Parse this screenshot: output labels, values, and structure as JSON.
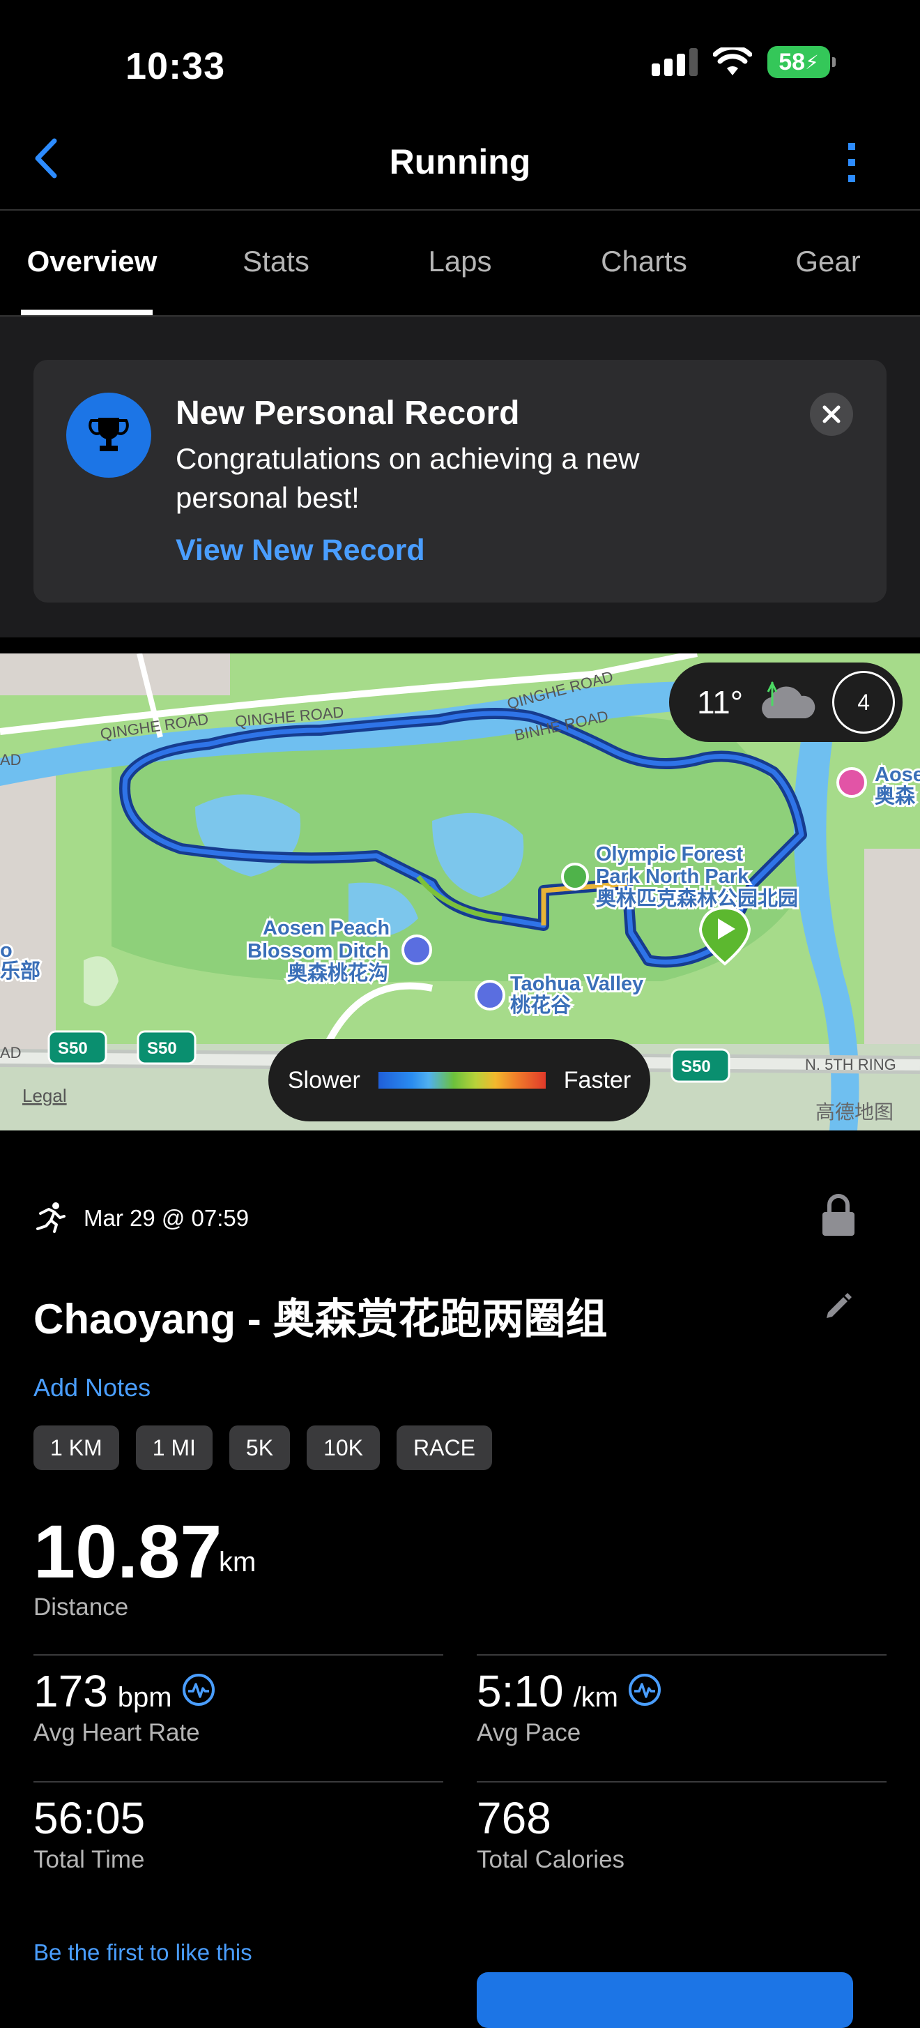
{
  "status": {
    "time": "10:33",
    "battery": "58"
  },
  "nav": {
    "title": "Running"
  },
  "tabs": [
    "Overview",
    "Stats",
    "Laps",
    "Charts",
    "Gear"
  ],
  "record_card": {
    "title": "New Personal Record",
    "text": "Congratulations on achieving a new personal best!",
    "link": "View New Record"
  },
  "map": {
    "weather_temp": "11°",
    "weather_badge": "4",
    "legend_slow": "Slower",
    "legend_fast": "Faster",
    "legal": "Legal",
    "provider": "高德地图",
    "labels": {
      "qinghe_road_1": "QINGHE ROAD",
      "qinghe_road_2": "QINGHE ROAD",
      "qinghe_road_3": "QINGHE ROAD",
      "binhe_road": "BINHE ROAD",
      "n5th_ring": "N. 5TH RING",
      "s50": "S50",
      "olympic_en_1": "Olympic Forest",
      "olympic_en_2": "Park North Park",
      "olympic_cn": "奥林匹克森林公园北园",
      "aosen_en_1": "Aosen Peach",
      "aosen_en_2": "Blossom Ditch",
      "aosen_cn": "奥森桃花沟",
      "taohua_en": "Taohua Valley",
      "taohua_cn": "桃花谷",
      "edge_right_en": "Aose",
      "edge_right_cn": "奥森",
      "edge_left_cn": "乐部",
      "edge_left_en": "o",
      "edge_ad_1": "AD",
      "edge_ad_2": "AD"
    }
  },
  "activity": {
    "date": "Mar 29 @ 07:59",
    "title": "Chaoyang - 奥森赏花跑两圈组",
    "add_notes": "Add Notes",
    "chips": [
      "1 KM",
      "1 MI",
      "5K",
      "10K",
      "RACE"
    ],
    "distance": {
      "value": "10.87",
      "unit": "km",
      "label": "Distance"
    },
    "heart_rate": {
      "value": "173",
      "unit": "bpm",
      "label": "Avg Heart Rate"
    },
    "pace": {
      "value": "5:10",
      "unit": "/km",
      "label": "Avg Pace"
    },
    "total_time": {
      "value": "56:05",
      "label": "Total Time"
    },
    "calories": {
      "value": "768",
      "label": "Total Calories"
    },
    "like_text": "Be the first to like this"
  },
  "colors": {
    "accent": "#4a9eff",
    "brand_blue": "#1c75e6",
    "battery": "#34c759"
  }
}
